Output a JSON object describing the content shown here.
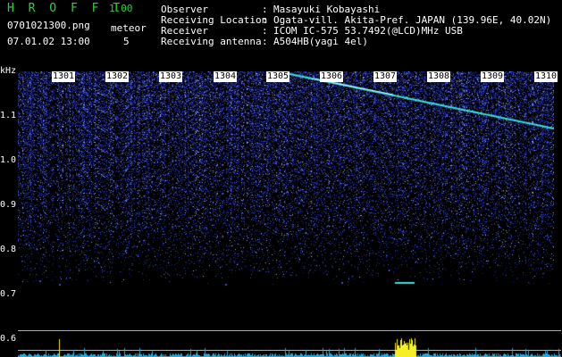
{
  "app": {
    "name": "H R O F F T",
    "version": "1.00"
  },
  "file": {
    "name": "0701021300.png",
    "datetime": "07.01.02 13:00"
  },
  "meteor": {
    "label": "meteor",
    "count": "5"
  },
  "info": [
    {
      "label": "Observer",
      "colon": ":",
      "value": "Masayuki Kobayashi"
    },
    {
      "label": "Receiving Location",
      "colon": ":",
      "value": "Ogata-vill. Akita-Pref. JAPAN (139.96E, 40.02N)"
    },
    {
      "label": "Receiver",
      "colon": ":",
      "value": "ICOM IC-575 53.7492(@LCD)MHz USB"
    },
    {
      "label": "Receiving antenna",
      "colon": ":",
      "value": "A504HB(yagi 4el)"
    }
  ],
  "yaxis": {
    "unit": "kHz",
    "ticks": [
      "1.1",
      "1.0",
      "0.9",
      "0.8",
      "0.7",
      "0.6"
    ]
  },
  "xaxis": {
    "ticks": [
      "1301",
      "1302",
      "1303",
      "1304",
      "1305",
      "1306",
      "1307",
      "1308",
      "1309",
      "1310"
    ]
  },
  "colors": {
    "header_green": "#2bd13a",
    "noise_blue": "#2e3fbf",
    "meteor_trail": "#37e0e0",
    "baseline_cyan": "#2aa9d8",
    "burst_yellow": "#f5ef2a"
  }
}
